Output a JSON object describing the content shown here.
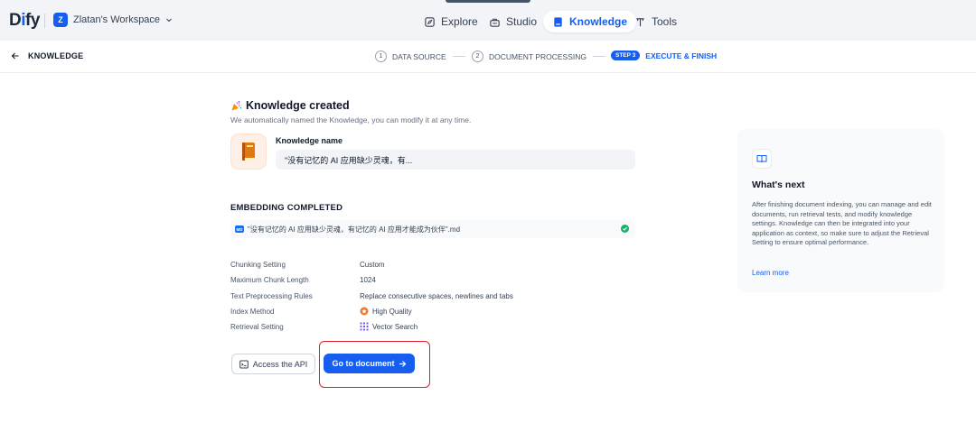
{
  "app": {
    "logo_text_a": "D",
    "logo_text_i": "i",
    "logo_text_b": "fy"
  },
  "workspace": {
    "badge": "Z",
    "name": "Zlatan's Workspace"
  },
  "nav": {
    "explore": "Explore",
    "studio": "Studio",
    "knowledge": "Knowledge",
    "tools": "Tools"
  },
  "stepbar": {
    "back_label": "KNOWLEDGE",
    "step1_num": "1",
    "step1_label": "DATA SOURCE",
    "step2_num": "2",
    "step2_label": "DOCUMENT PROCESSING",
    "step3_pill": "STEP 3",
    "step3_label": "EXECUTE & FINISH"
  },
  "main": {
    "title": "Knowledge created",
    "subtitle": "We automatically named the Knowledge, you can modify it at any time.",
    "name_label": "Knowledge name",
    "name_value": "\"没有记忆的 AI 应用缺少灵魂，有...",
    "embedding_title": "EMBEDDING COMPLETED",
    "file_badge": "MD",
    "file_name": "\"没有记忆的 AI 应用缺少灵魂，有记忆的 AI 应用才能成为伙伴\".md"
  },
  "settings": [
    {
      "label": "Chunking Setting",
      "value": "Custom"
    },
    {
      "label": "Maximum Chunk Length",
      "value": "1024"
    },
    {
      "label": "Text Preprocessing Rules",
      "value": "Replace consecutive spaces, newlines and tabs"
    },
    {
      "label": "Index Method",
      "value": "High Quality"
    },
    {
      "label": "Retrieval Setting",
      "value": "Vector Search"
    }
  ],
  "buttons": {
    "api": "Access the API",
    "go": "Go to document"
  },
  "next": {
    "title": "What's next",
    "body": "After finishing document indexing, you can manage and edit documents, run retrieval tests, and modify knowledge settings. Knowledge can then be integrated into your application as context, so make sure to adjust the Retrieval Setting to ensure optimal performance.",
    "learn_more": "Learn more"
  },
  "colors": {
    "accent": "#155eef",
    "success": "#17b26a",
    "highlight": "#e11d2a",
    "index_orange": "#f0782a",
    "retrieval_purple": "#7a5af8"
  },
  "icons": [
    "explore-icon",
    "studio-icon",
    "knowledge-icon",
    "tools-icon",
    "arrow-left-icon",
    "party-icon",
    "book-icon",
    "md-file-icon",
    "check-circle-icon",
    "high-quality-icon",
    "vector-search-icon",
    "terminal-icon",
    "arrow-right-icon",
    "open-book-icon",
    "chevron-down-icon"
  ]
}
